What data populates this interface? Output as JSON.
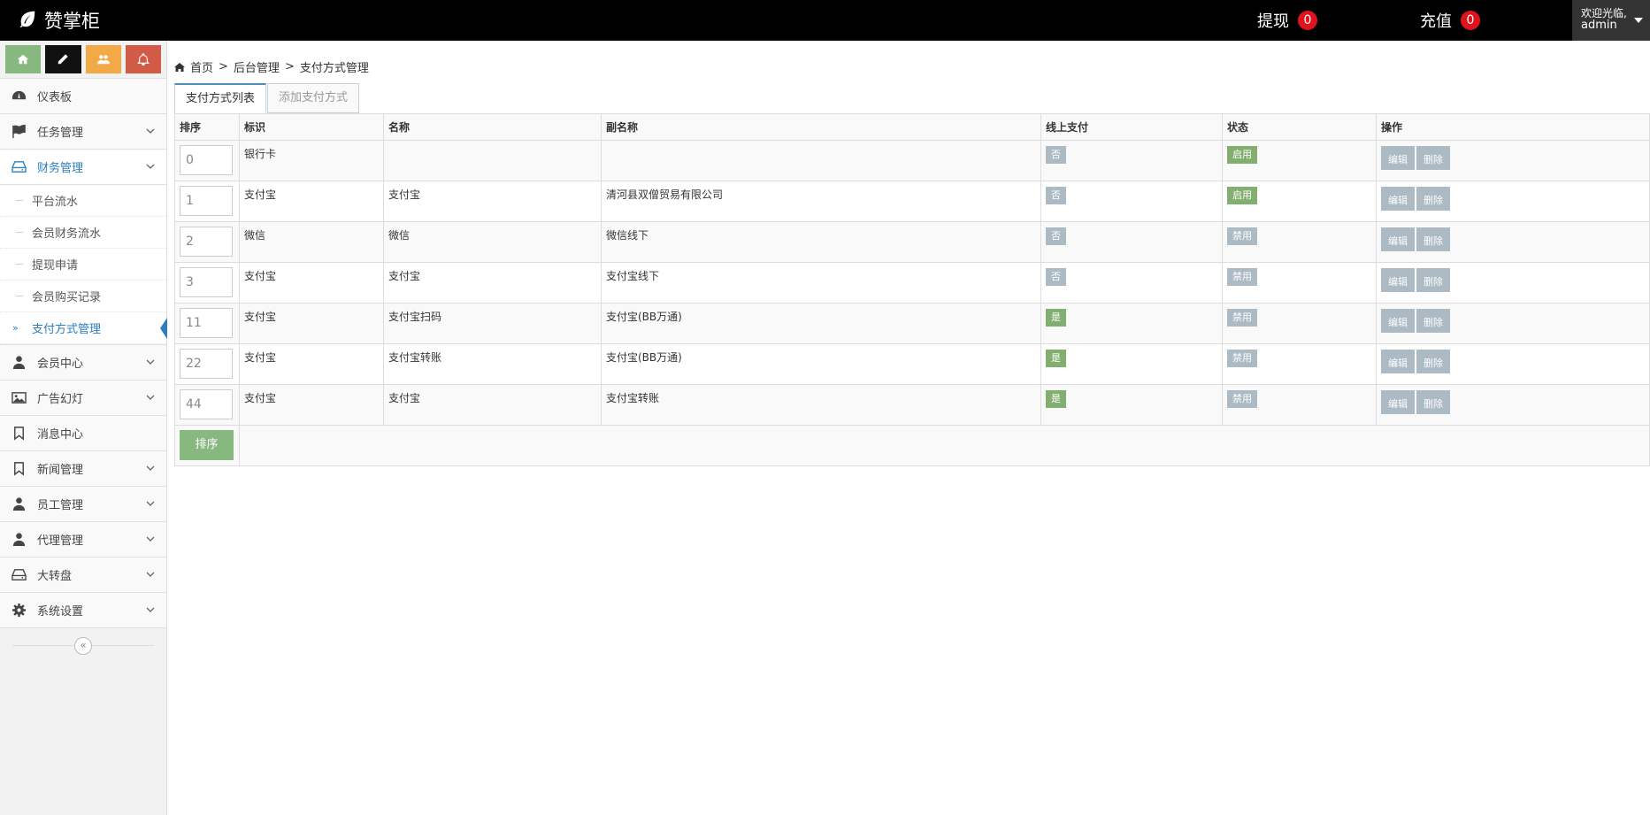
{
  "topbar": {
    "brand": "赞掌柜",
    "withdraw_label": "提现",
    "withdraw_count": "0",
    "recharge_label": "充值",
    "recharge_count": "0",
    "welcome": "欢迎光临,",
    "username": "admin"
  },
  "shortcuts": [
    {
      "icon": "home-icon",
      "color": "#87b87f"
    },
    {
      "icon": "pencil-icon",
      "color": "#111111"
    },
    {
      "icon": "users-icon",
      "color": "#f4a947"
    },
    {
      "icon": "bell-icon",
      "color": "#d15b47"
    }
  ],
  "sidebar": {
    "dashboard": "仪表板",
    "tasks": "任务管理",
    "finance": "财务管理",
    "finance_sub": [
      "平台流水",
      "会员财务流水",
      "提现申请",
      "会员购买记录",
      "支付方式管理"
    ],
    "members": "会员中心",
    "ads": "广告幻灯",
    "messages": "消息中心",
    "news": "新闻管理",
    "staff": "员工管理",
    "agents": "代理管理",
    "wheel": "大转盘",
    "settings": "系统设置"
  },
  "breadcrumb": {
    "home": "首页",
    "sep1": ">",
    "backend": "后台管理",
    "sep2": ">",
    "current": "支付方式管理"
  },
  "tabs": {
    "list": "支付方式列表",
    "add": "添加支付方式"
  },
  "table": {
    "headers": [
      "排序",
      "标识",
      "名称",
      "副名称",
      "线上支付",
      "状态",
      "操作"
    ],
    "rows": [
      {
        "order": "0",
        "tag": "银行卡",
        "name": "",
        "subname": "",
        "online": "否",
        "status": "启用"
      },
      {
        "order": "1",
        "tag": "支付宝",
        "name": "支付宝",
        "subname": "清河县双僧贸易有限公司",
        "online": "否",
        "status": "启用"
      },
      {
        "order": "2",
        "tag": "微信",
        "name": "微信",
        "subname": "微信线下",
        "online": "否",
        "status": "禁用"
      },
      {
        "order": "3",
        "tag": "支付宝",
        "name": "支付宝",
        "subname": "支付宝线下",
        "online": "否",
        "status": "禁用"
      },
      {
        "order": "11",
        "tag": "支付宝",
        "name": "支付宝扫码",
        "subname": "支付宝(BB万通)",
        "online": "是",
        "status": "禁用"
      },
      {
        "order": "22",
        "tag": "支付宝",
        "name": "支付宝转账",
        "subname": "支付宝(BB万通)",
        "online": "是",
        "status": "禁用"
      },
      {
        "order": "44",
        "tag": "支付宝",
        "name": "支付宝",
        "subname": "支付宝转账",
        "online": "是",
        "status": "禁用"
      }
    ],
    "edit_label": "编辑",
    "delete_label": "删除",
    "sort_button": "排序"
  },
  "colors": {
    "label_gray": "#abbac3",
    "label_green": "#82af6f",
    "accent_blue": "#2b7dbc",
    "badge_red": "#e0121d"
  }
}
